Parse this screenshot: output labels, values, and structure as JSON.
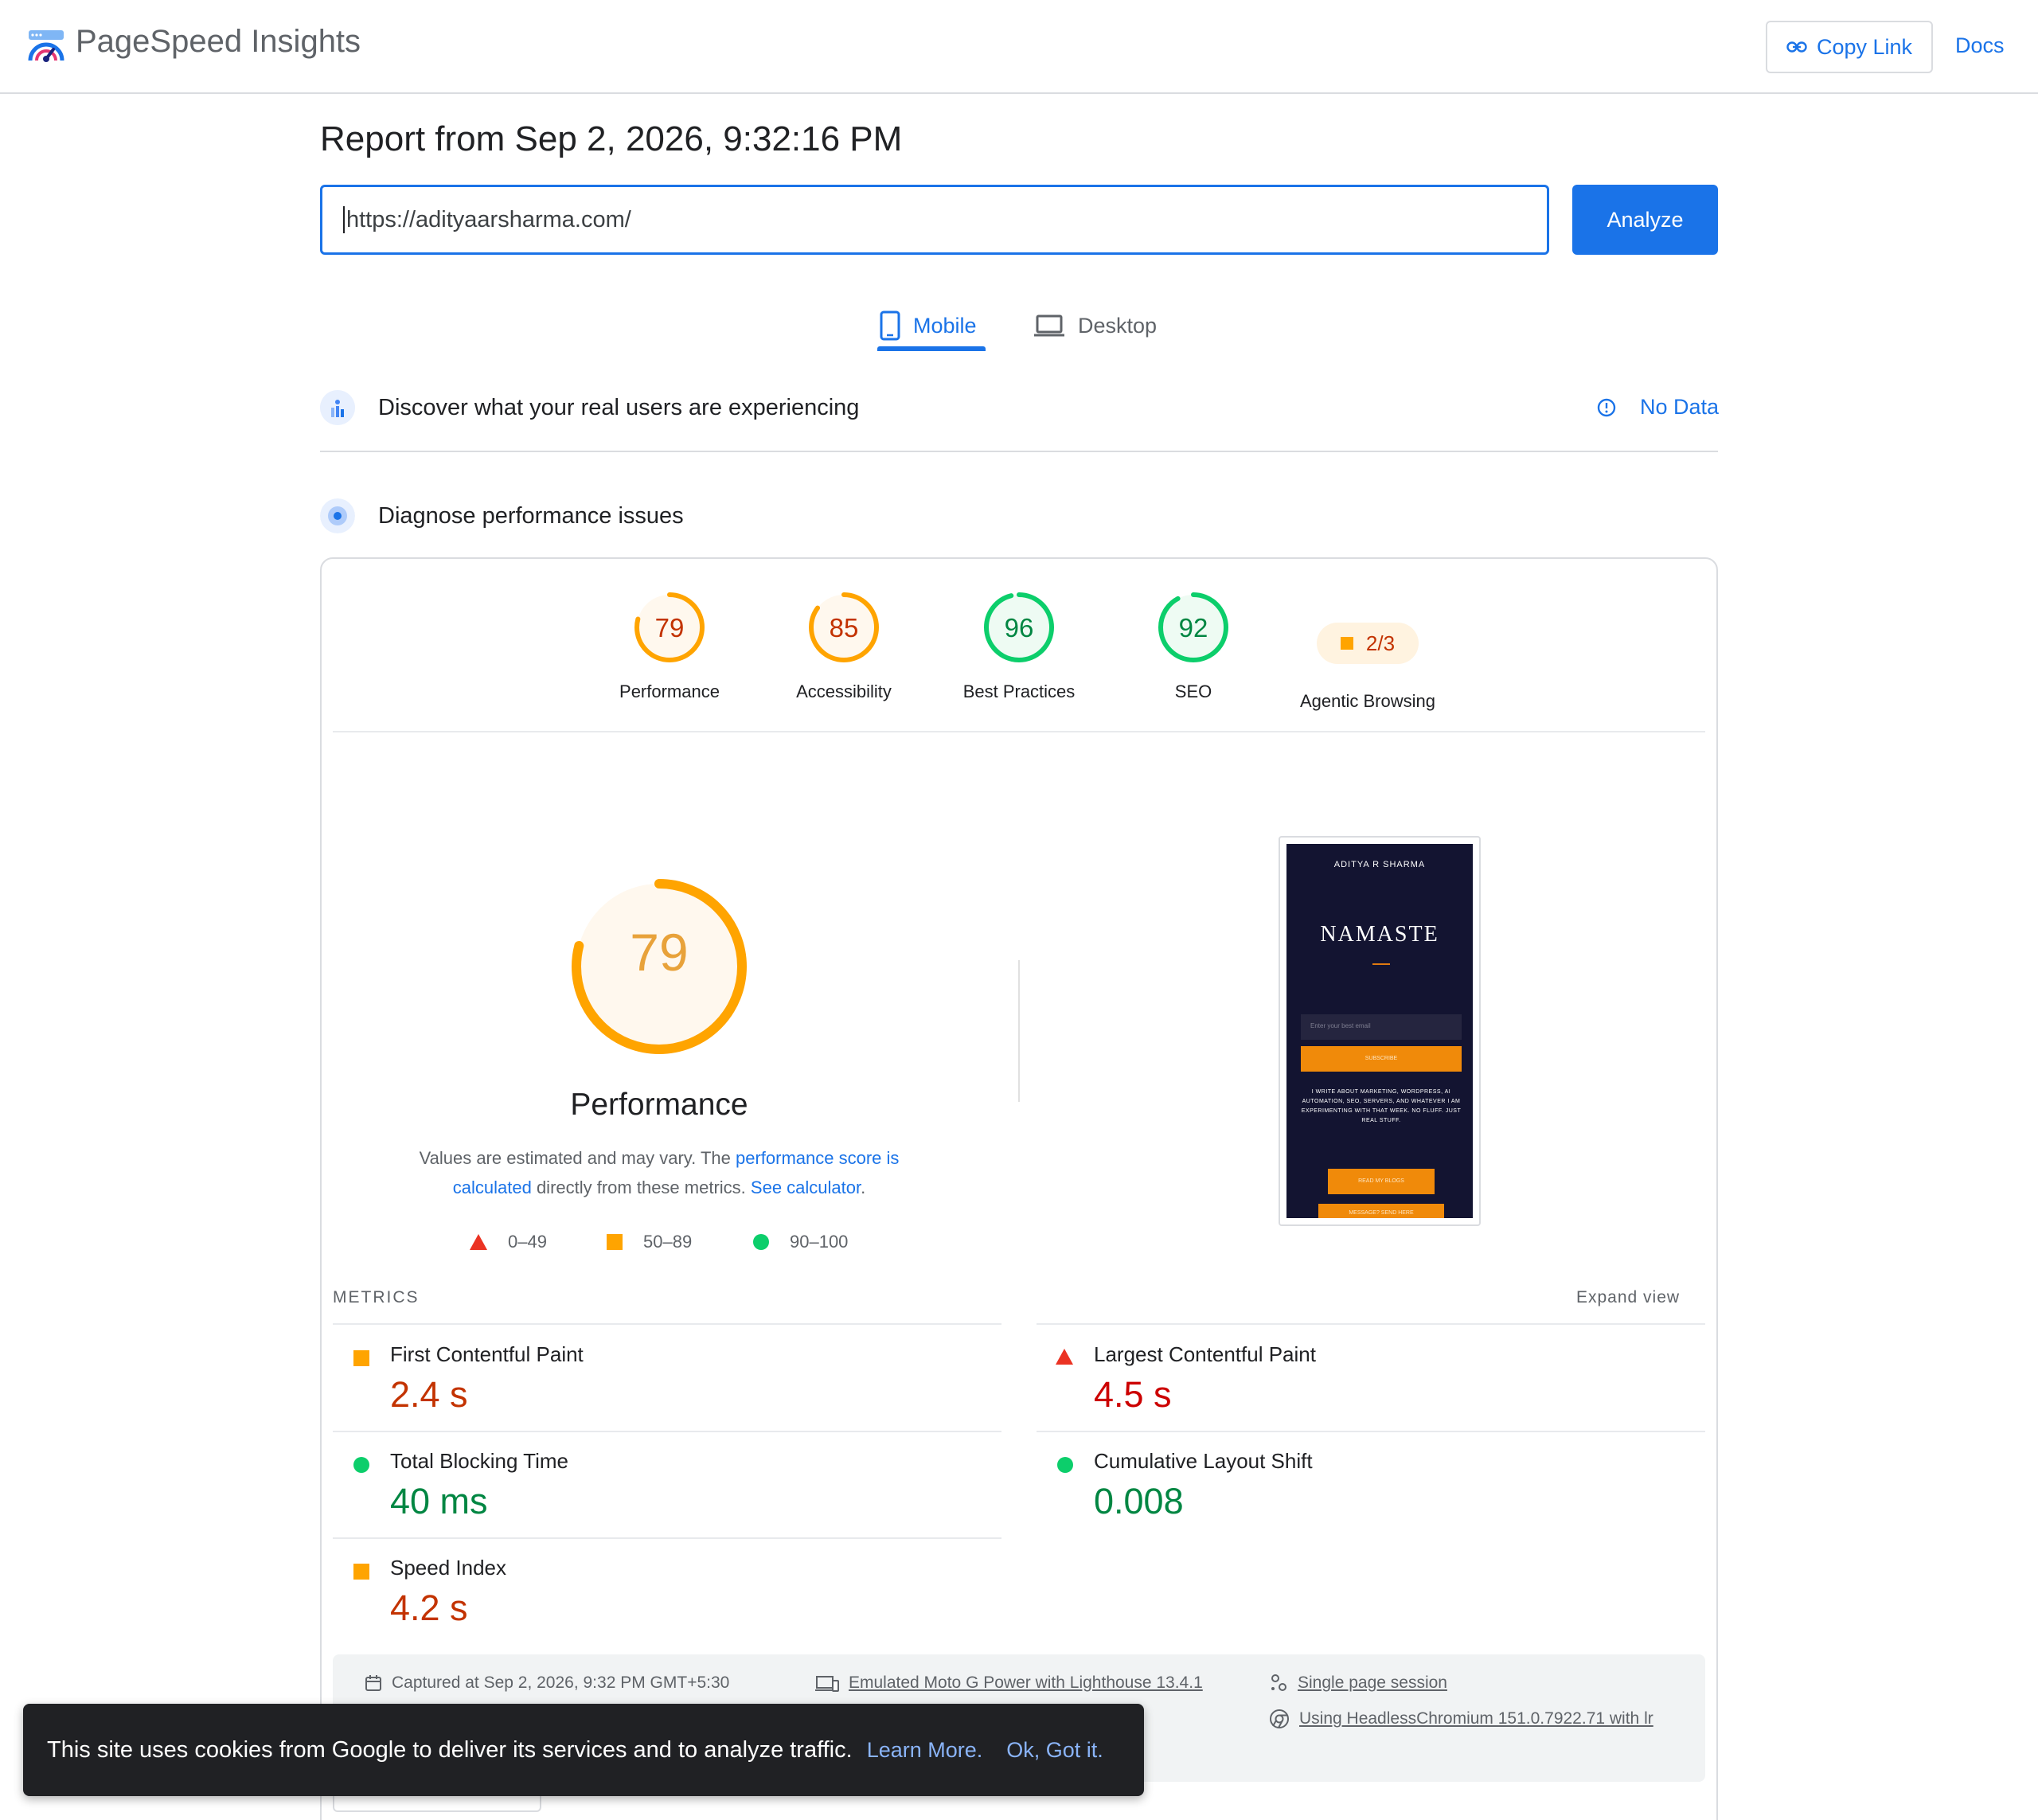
{
  "header": {
    "brand": "PageSpeed Insights",
    "copy_link": "Copy Link",
    "docs": "Docs",
    "logo_icon": "pagespeed-logo-icon",
    "link_icon": "link-icon"
  },
  "report": {
    "title": "Report from Sep 2, 2026, 9:32:16 PM",
    "url_value": "https://adityaarsharma.com/",
    "analyze": "Analyze"
  },
  "tabs": [
    {
      "label": "Mobile",
      "icon": "phone-icon",
      "active": true
    },
    {
      "label": "Desktop",
      "icon": "laptop-icon",
      "active": false
    }
  ],
  "sections": {
    "real_users_title": "Discover what your real users are experiencing",
    "no_data": "No Data",
    "diagnose_title": "Diagnose performance issues"
  },
  "scores": [
    {
      "label": "Performance",
      "value": "79",
      "status": "average",
      "fraction": 0.79
    },
    {
      "label": "Accessibility",
      "value": "85",
      "status": "average",
      "fraction": 0.85
    },
    {
      "label": "Best Practices",
      "value": "96",
      "status": "pass",
      "fraction": 0.96
    },
    {
      "label": "SEO",
      "value": "92",
      "status": "pass",
      "fraction": 0.92
    },
    {
      "label": "Agentic Browsing",
      "value": "2/3",
      "status": "average"
    }
  ],
  "performance": {
    "score": "79",
    "fraction": 0.79,
    "title": "Performance",
    "desc_pre": "Values are estimated and may vary. The ",
    "desc_link1": "performance score is calculated",
    "desc_mid": " directly from these metrics. ",
    "desc_link2": "See calculator",
    "desc_post": ".",
    "legend": [
      {
        "range": "0–49",
        "shape": "triangle"
      },
      {
        "range": "50–89",
        "shape": "square"
      },
      {
        "range": "90–100",
        "shape": "circle"
      }
    ]
  },
  "screenshot": {
    "site_name": "ADITYA R SHARMA",
    "headline": "NAMASTE",
    "email_placeholder": "Enter your best email",
    "subscribe": "SUBSCRIBE",
    "copy": "I WRITE ABOUT MARKETING, WORDPRESS, AI AUTOMATION, SEO, SERVERS, AND WHATEVER I AM EXPERIMENTING WITH THAT WEEK. NO FLUFF. JUST REAL STUFF.",
    "blogs_btn": "READ MY BLOGS",
    "message_btn": "MESSAGE? SEND HERE"
  },
  "metrics": {
    "label": "METRICS",
    "expand": "Expand view",
    "items": [
      {
        "name": "First Contentful Paint",
        "value": "2.4 s",
        "status": "average"
      },
      {
        "name": "Largest Contentful Paint",
        "value": "4.5 s",
        "status": "fail"
      },
      {
        "name": "Total Blocking Time",
        "value": "40 ms",
        "status": "pass"
      },
      {
        "name": "Cumulative Layout Shift",
        "value": "0.008",
        "status": "pass"
      },
      {
        "name": "Speed Index",
        "value": "4.2 s",
        "status": "average"
      }
    ]
  },
  "info": {
    "captured": "Captured at Sep 2, 2026, 9:32 PM GMT+5:30",
    "emulated": "Emulated Moto G Power with Lighthouse 13.4.1",
    "session": "Single page session",
    "browser": "Using HeadlessChromium 151.0.7922.71 with lr"
  },
  "cookie": {
    "text": "This site uses cookies from Google to deliver its services and to analyze traffic.",
    "learn_more": "Learn More.",
    "ok": "Ok, Got it."
  },
  "colors": {
    "accent": "#1a73e8",
    "average": "#ffa400",
    "pass": "#0cce6b",
    "fail": "#eb3323"
  }
}
